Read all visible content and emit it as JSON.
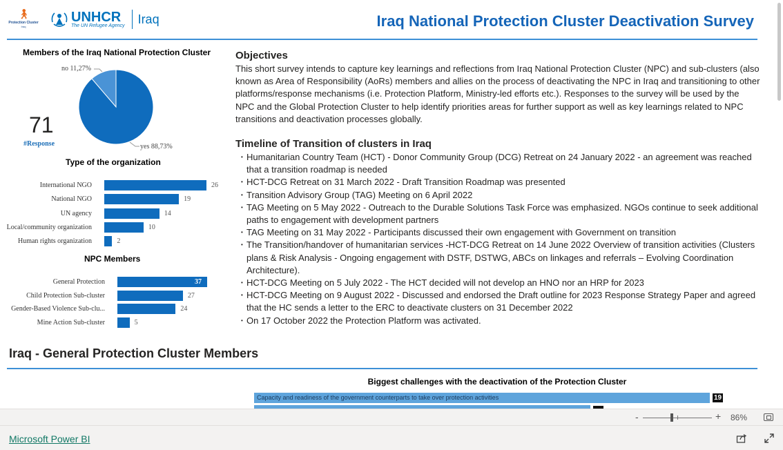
{
  "header": {
    "title": "Iraq National Protection Cluster Deactivation Survey",
    "logo_pc_line1": "Protection Cluster",
    "logo_pc_line2": "Iraq",
    "logo_unhcr_name": "UNHCR",
    "logo_unhcr_tagline": "The UN Refugee Agency",
    "logo_country": "Iraq"
  },
  "members_pie": {
    "title": "Members of the Iraq National Protection Cluster",
    "kpi_value": "71",
    "kpi_label": "#Response",
    "chart_data": {
      "type": "pie",
      "title": "Members of the Iraq National Protection Cluster",
      "slices": [
        {
          "label": "yes",
          "value": 88.73,
          "text": "yes 88,73%",
          "color": "#0f6cbd"
        },
        {
          "label": "no",
          "value": 11.27,
          "text": "no 11,27%",
          "color": "#4a93d6"
        }
      ]
    }
  },
  "org_type": {
    "title": "Type of the organization",
    "chart_data": {
      "type": "bar",
      "orientation": "horizontal",
      "title": "Type of the organization",
      "categories": [
        "International NGO",
        "National NGO",
        "UN agency",
        "Local/community organization",
        "Human rights organization"
      ],
      "values": [
        26,
        19,
        14,
        10,
        2
      ],
      "color": "#0f6cbd"
    }
  },
  "npc_members": {
    "title": "NPC Members",
    "chart_data": {
      "type": "bar",
      "orientation": "horizontal",
      "title": "NPC Members",
      "categories": [
        "General Protection",
        "Child Protection Sub-cluster",
        "Gender-Based Violence Sub-clu...",
        "Mine Action Sub-cluster"
      ],
      "values": [
        37,
        27,
        24,
        5
      ],
      "color": "#0f6cbd"
    }
  },
  "objectives": {
    "heading": "Objectives",
    "body": "This short survey intends to capture key learnings and reflections from Iraq National Protection Cluster (NPC) and sub-clusters (also known as Area of Responsibility (AoRs) members and allies on the process of deactivating the NPC in Iraq and transitioning to other platforms/response mechanisms (i.e. Protection Platform, Ministry-led efforts etc.). Responses to the survey will be used by the NPC and the Global Protection Cluster to help identify priorities areas for further support as well as key learnings related to NPC transitions and deactivation processes globally."
  },
  "timeline": {
    "heading": "Timeline of Transition of clusters in Iraq",
    "items": [
      "Humanitarian Country Team (HCT) - Donor Community Group (DCG) Retreat on 24 January 2022 - an agreement was reached that a transition roadmap is needed",
      "HCT-DCG Retreat on 31 March 2022 - Draft Transition Roadmap was presented",
      "Transition Advisory Group (TAG) Meeting on 6 April 2022",
      "TAG Meeting on 5 May 2022 - Outreach to the Durable Solutions Task Force was emphasized. NGOs continue to seek additional paths to engagement with development partners",
      "TAG Meeting on 31 May 2022 - Participants discussed their own engagement with Government on transition",
      "The Transition/handover of humanitarian services -HCT-DCG Retreat on 14 June 2022 Overview of transition activities (Clusters plans & Risk Analysis - Ongoing engagement with DSTF, DSTWG, ABCs on linkages and referrals – Evolving Coordination Architecture).",
      "HCT-DCG Meeting on 5 July 2022 - The HCT decided will not develop an HNO nor an HRP for 2023",
      "HCT-DCG Meeting on 9 August 2022 - Discussed and endorsed the Draft outline for 2023 Response Strategy Paper and agreed that the HC sends a letter to the ERC to deactivate clusters on 31 December 2022",
      "On 17 October 2022 the Protection Platform was activated."
    ]
  },
  "general_section": {
    "heading": "Iraq - General Protection Cluster Members"
  },
  "challenges": {
    "title": "Biggest challenges with the deactivation of the Protection Cluster",
    "chart_data": {
      "type": "bar",
      "orientation": "horizontal",
      "title": "Biggest challenges with the deactivation of the Protection Cluster",
      "categories": [
        "Capacity and readiness of the government counterparts to take over protection activities",
        ""
      ],
      "values": [
        19,
        null
      ],
      "color": "#5ea4dc"
    }
  },
  "toolbar": {
    "zoom_minus": "-",
    "zoom_plus": "+",
    "zoom_level": "86%",
    "zoom_fraction": 0.43
  },
  "footer": {
    "brand": "Microsoft Power BI"
  },
  "icons": [
    "pie-chart",
    "zoom-slider",
    "fit-to-page-icon",
    "share-icon",
    "expand-icon"
  ]
}
